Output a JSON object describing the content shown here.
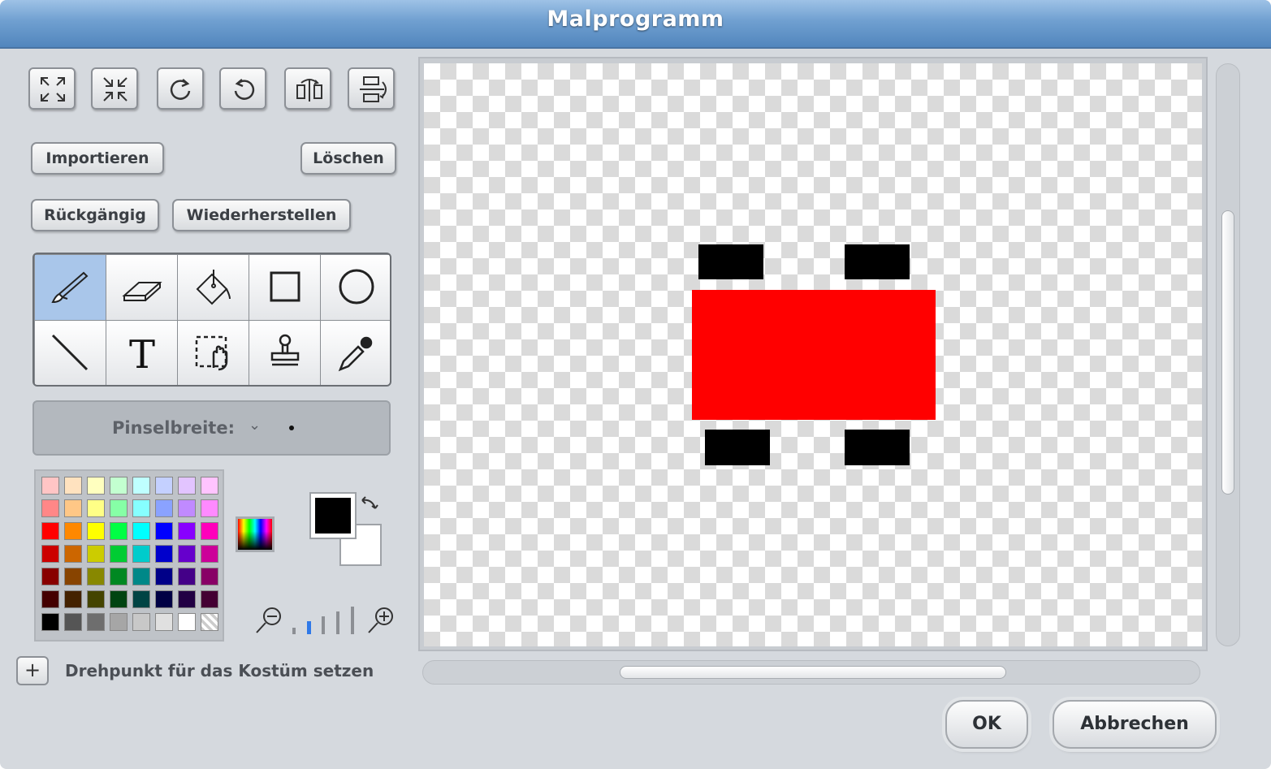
{
  "window": {
    "title": "Malprogramm"
  },
  "transform_buttons": [
    {
      "name": "grow-icon"
    },
    {
      "name": "shrink-icon"
    },
    {
      "name": "rotate-left-icon"
    },
    {
      "name": "rotate-right-icon"
    },
    {
      "name": "flip-horizontal-icon"
    },
    {
      "name": "flip-vertical-icon"
    }
  ],
  "buttons": {
    "import": "Importieren",
    "clear": "Löschen",
    "undo": "Rückgängig",
    "redo": "Wiederherstellen"
  },
  "tools": {
    "selected": "paintbrush",
    "items": [
      "paintbrush",
      "eraser",
      "fill",
      "rectangle",
      "ellipse",
      "line",
      "text",
      "select",
      "stamp",
      "eyedropper"
    ]
  },
  "brush": {
    "label": "Pinselbreite:",
    "arrow": "⌄"
  },
  "palette": {
    "rows": [
      [
        "#ffc5c5",
        "#ffe2bf",
        "#ffffbf",
        "#c3ffd0",
        "#bfffff",
        "#c4d0ff",
        "#e2c4ff",
        "#ffc4ff"
      ],
      [
        "#ff8787",
        "#ffc786",
        "#ffff86",
        "#86ffa6",
        "#86ffff",
        "#8aa2ff",
        "#c08aff",
        "#ff8aff"
      ],
      [
        "#ff0000",
        "#ff8800",
        "#ffff00",
        "#00ff44",
        "#00ffff",
        "#0000ff",
        "#8800ff",
        "#ff00bb"
      ],
      [
        "#cc0000",
        "#cc6600",
        "#cccc00",
        "#00cc33",
        "#00cccc",
        "#0000cc",
        "#6600cc",
        "#cc0099"
      ],
      [
        "#880000",
        "#884400",
        "#888800",
        "#008822",
        "#008888",
        "#000088",
        "#440088",
        "#880066"
      ],
      [
        "#440000",
        "#442200",
        "#444400",
        "#004411",
        "#004444",
        "#000044",
        "#220044",
        "#440033"
      ],
      [
        "#000000",
        "#555555",
        "#6e6e6e",
        "#a6a6a6",
        "#c8c8c8",
        "#e0e0e0",
        "#ffffff",
        "transparent"
      ]
    ]
  },
  "colors": {
    "foreground": "#000000",
    "background": "#ffffff"
  },
  "zoom": {
    "level_index": 1,
    "levels": 5
  },
  "rotation_center": {
    "label": "Drehpunkt für das Kostüm setzen"
  },
  "dialog": {
    "ok": "OK",
    "cancel": "Abbrechen"
  },
  "canvas_shapes": [
    {
      "name": "red-body-rectangle",
      "color": "#ff0000"
    },
    {
      "name": "black-wheel-top-left",
      "color": "#000000"
    },
    {
      "name": "black-wheel-top-right",
      "color": "#000000"
    },
    {
      "name": "black-wheel-bottom-left",
      "color": "#000000"
    },
    {
      "name": "black-wheel-bottom-right",
      "color": "#000000"
    }
  ]
}
